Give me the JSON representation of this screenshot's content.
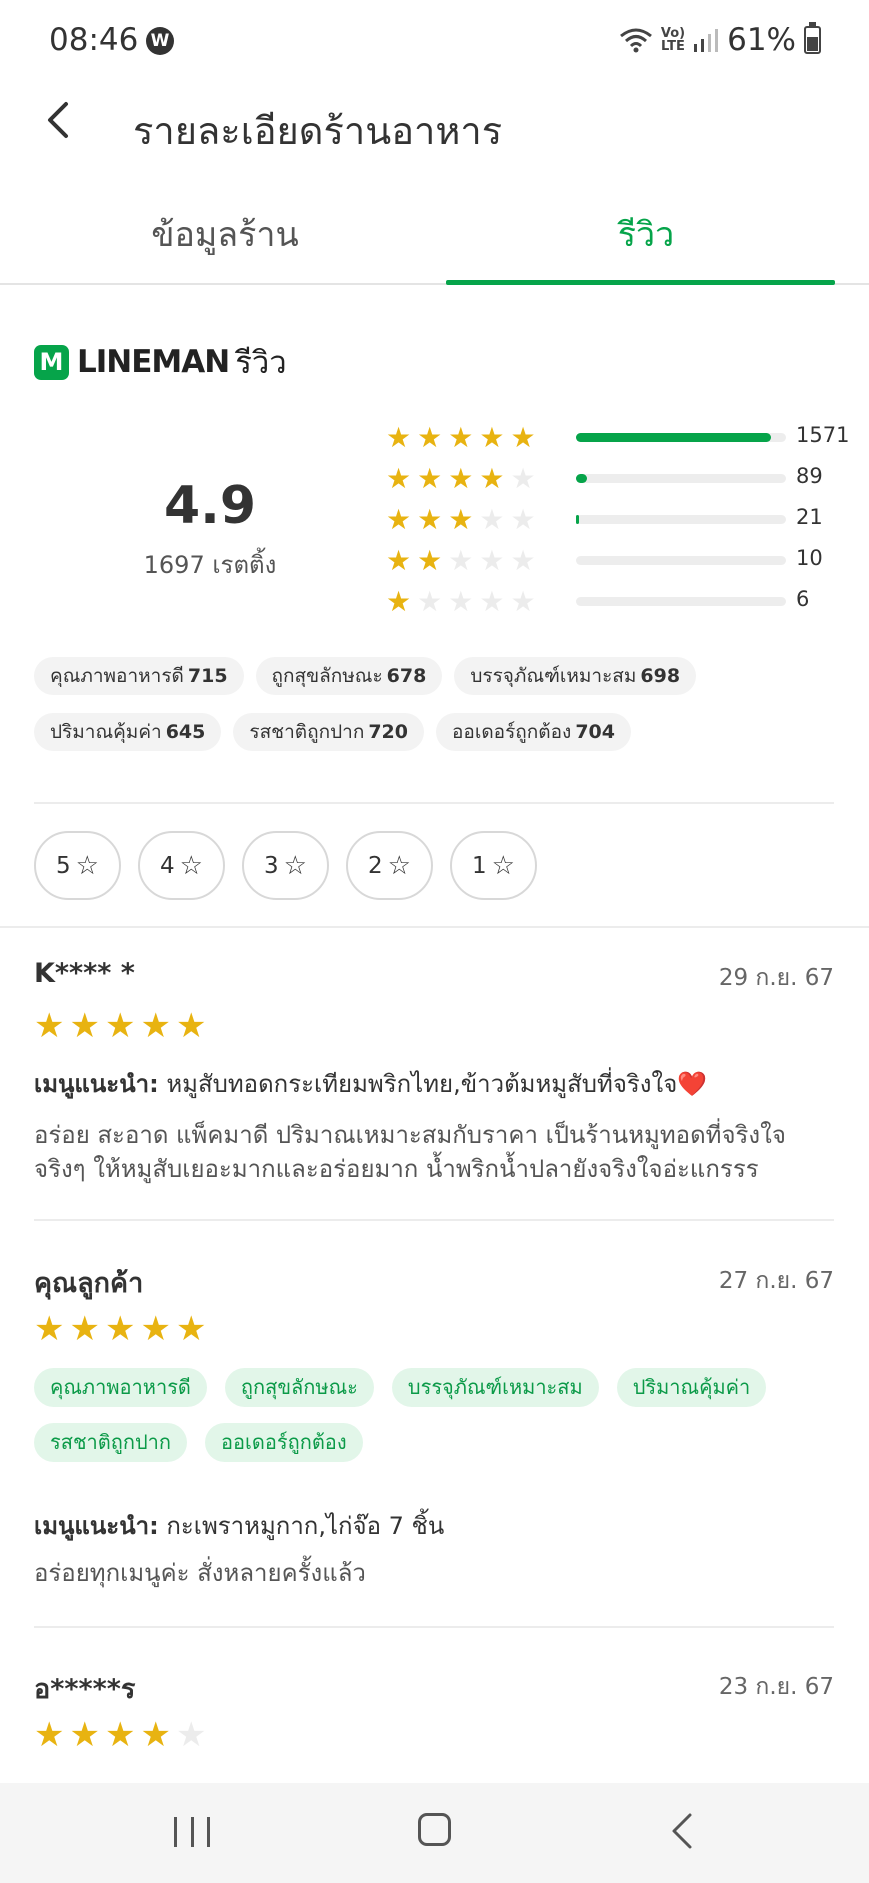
{
  "status_bar": {
    "time": "08:46",
    "w_badge": "W",
    "volte_top": "Vo)",
    "volte_bottom": "LTE",
    "battery": "61%"
  },
  "header": {
    "title": "รายละเอียดร้านอาหาร"
  },
  "tabs": [
    {
      "label": "ข้อมูลร้าน",
      "active": false
    },
    {
      "label": "รีวิว",
      "active": true
    }
  ],
  "brand": {
    "logo_letter": "M",
    "name": "LINEMAN",
    "suffix": "รีวิว"
  },
  "rating": {
    "average": "4.9",
    "count_label": "1697 เรตติ้ง",
    "distribution": [
      {
        "stars": 5,
        "count": "1571",
        "fraction": 0.93
      },
      {
        "stars": 4,
        "count": "89",
        "fraction": 0.053
      },
      {
        "stars": 3,
        "count": "21",
        "fraction": 0.012
      },
      {
        "stars": 2,
        "count": "10",
        "fraction": 0.0
      },
      {
        "stars": 1,
        "count": "6",
        "fraction": 0.0
      }
    ]
  },
  "attributes": [
    {
      "label": "คุณภาพอาหารดี",
      "count": "715"
    },
    {
      "label": "ถูกสุขลักษณะ",
      "count": "678"
    },
    {
      "label": "บรรจุภัณฑ์เหมาะสม",
      "count": "698"
    },
    {
      "label": "ปริมาณคุ้มค่า",
      "count": "645"
    },
    {
      "label": "รสชาติถูกปาก",
      "count": "720"
    },
    {
      "label": "ออเดอร์ถูกต้อง",
      "count": "704"
    }
  ],
  "filters": [
    "5",
    "4",
    "3",
    "2",
    "1"
  ],
  "reviews": [
    {
      "name": "K**** *",
      "date": "29 ก.ย. 67",
      "stars": 5,
      "menu_label": "เมนูแนะนำ:",
      "menu_items": "หมูสับทอดกระเทียมพริกไทย,ข้าวต้มหมูสับที่จริงใจ",
      "heart": "❤️",
      "text_line1": "อร่อย สะอาด แพ็คมาดี ปริมาณเหมาะสมกับราคา เป็นร้านหมูทอดที่จริงใจ",
      "text_line2": "จริงๆ ให้หมูสับเยอะมากและอร่อยมาก น้ำพริกน้ำปลายังจริงใจอ่ะแกรรร"
    },
    {
      "name": "คุณลูกค้า",
      "date": "27 ก.ย. 67",
      "stars": 5,
      "tags": [
        "คุณภาพอาหารดี",
        "ถูกสุขลักษณะ",
        "บรรจุภัณฑ์เหมาะสม",
        "ปริมาณคุ้มค่า",
        "รสชาติถูกปาก",
        "ออเดอร์ถูกต้อง"
      ],
      "menu_label": "เมนูแนะนำ:",
      "menu_items": "กะเพราหมูกาก,ไก่จ๊อ 7 ชิ้น",
      "text_line1": "อร่อยทุกเมนูค่ะ สั่งหลายครั้งแล้ว"
    },
    {
      "name": "อ*****ร",
      "date": "23 ก.ย. 67",
      "stars": 4
    }
  ],
  "colors": {
    "accent": "#06a44a",
    "star": "#e8b311",
    "star_empty": "#ececec",
    "tag_bg": "#e2f6e9"
  },
  "icons": {
    "back": "chevron-left-icon",
    "star": "star-icon",
    "star_outline": "star-outline-icon"
  }
}
